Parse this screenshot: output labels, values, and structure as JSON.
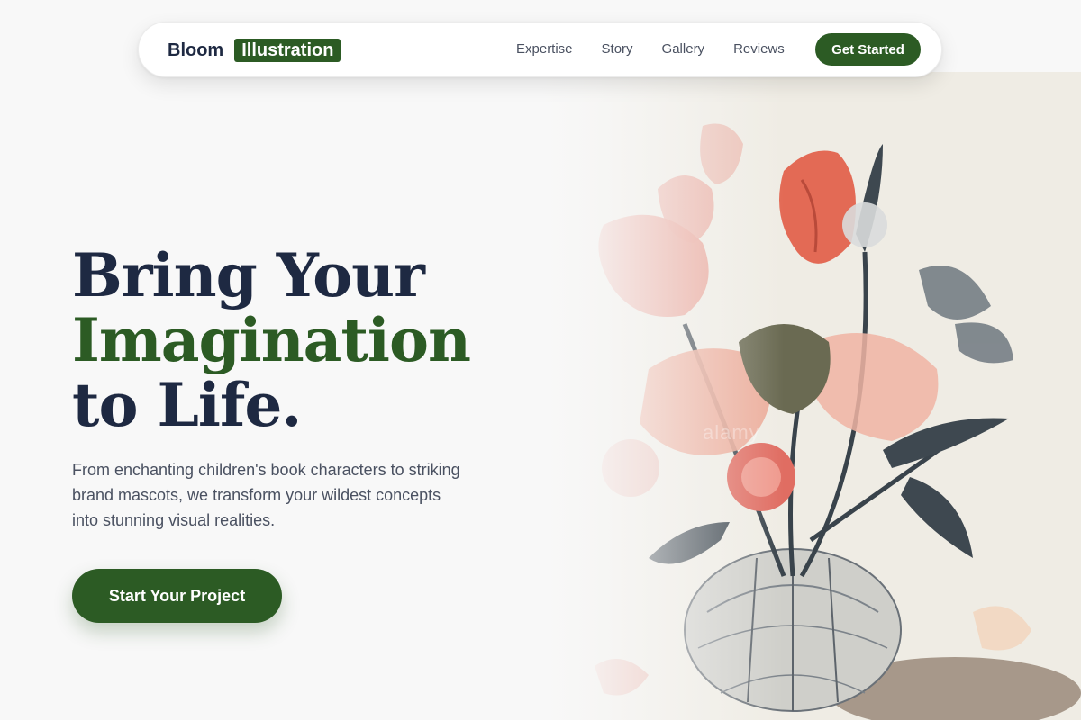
{
  "brand": {
    "name": "Bloom",
    "badge": "Illustration"
  },
  "nav": {
    "links": [
      "Expertise",
      "Story",
      "Gallery",
      "Reviews"
    ],
    "cta": "Get Started"
  },
  "hero": {
    "line1": "Bring Your",
    "line2": "Imagination",
    "line3": "to Life.",
    "subtext": "From enchanting children's book characters to striking brand mascots, we transform your wildest concepts into stunning visual realities.",
    "cta": "Start Your Project",
    "image_watermark": "alamy"
  },
  "colors": {
    "accent": "#2c5b24",
    "heading": "#1e2942",
    "body_text": "#4a5161",
    "background": "#f8f8f8"
  }
}
